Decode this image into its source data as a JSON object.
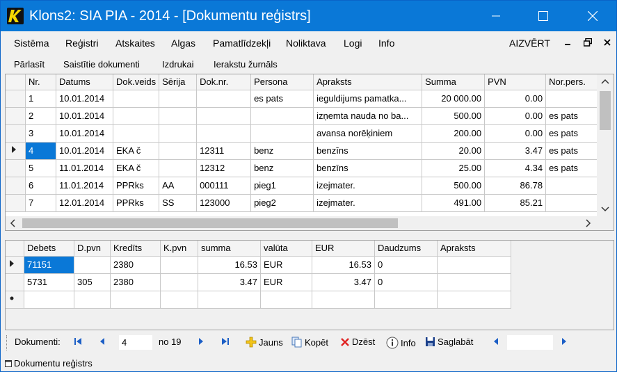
{
  "window": {
    "title": "Klons2: SIA PIA - 2014 - [Dokumentu reģistrs]"
  },
  "menu": {
    "items": [
      "Sistēma",
      "Reģistri",
      "Atskaites",
      "Algas",
      "Pamatlīdzekļi",
      "Noliktava",
      "Logi",
      "Info"
    ],
    "close_label": "AIZVĒRT"
  },
  "subtoolbar": [
    "Pārlasīt",
    "Saistītie dokumenti",
    "Izdrukai",
    "Ierakstu žurnāls"
  ],
  "documents": {
    "columns": [
      "Nr.",
      "Datums",
      "Dok.veids",
      "Sērija",
      "Dok.nr.",
      "Persona",
      "Apraksts",
      "Summa",
      "PVN",
      "Nor.pers."
    ],
    "rows": [
      [
        "1",
        "10.01.2014",
        "",
        "",
        "",
        "es pats",
        "ieguldijums pamatka...",
        "20 000.00",
        "0.00",
        ""
      ],
      [
        "2",
        "10.01.2014",
        "",
        "",
        "",
        "",
        "izņemta nauda no ba...",
        "500.00",
        "0.00",
        "es pats"
      ],
      [
        "3",
        "10.01.2014",
        "",
        "",
        "",
        "",
        "avansa norēķiniem",
        "200.00",
        "0.00",
        "es pats"
      ],
      [
        "4",
        "10.01.2014",
        "EKA č",
        "",
        "12311",
        "benz",
        "benzīns",
        "20.00",
        "3.47",
        "es pats"
      ],
      [
        "5",
        "11.01.2014",
        "EKA č",
        "",
        "12312",
        "benz",
        "benzīns",
        "25.00",
        "4.34",
        "es pats"
      ],
      [
        "6",
        "11.01.2014",
        "PPRks",
        "AA",
        "000111",
        "pieg1",
        "izejmater.",
        "500.00",
        "86.78",
        ""
      ],
      [
        "7",
        "12.01.2014",
        "PPRks",
        "SS",
        "123000",
        "pieg2",
        "izejmater.",
        "491.00",
        "85.21",
        ""
      ]
    ],
    "selected_row": 3
  },
  "entries": {
    "columns": [
      "Debets",
      "D.pvn",
      "Kredīts",
      "K.pvn",
      "summa",
      "valūta",
      "EUR",
      "Daudzums",
      "Apraksts"
    ],
    "rows": [
      [
        "71151",
        "",
        "2380",
        "",
        "16.53",
        "EUR",
        "16.53",
        "0",
        ""
      ],
      [
        "5731",
        "305",
        "2380",
        "",
        "3.47",
        "EUR",
        "3.47",
        "0",
        ""
      ]
    ]
  },
  "navigator": {
    "label": "Dokumenti:",
    "position": "4",
    "of_label": "no 19",
    "new_label": "Jauns",
    "copy_label": "Kopēt",
    "delete_label": "Dzēst",
    "info_label": "Info",
    "save_label": "Saglabāt"
  },
  "statusbar": {
    "tab": "Dokumentu reģistrs"
  },
  "colors": {
    "titlebar": "#0a78d7",
    "selection": "#0a78d7",
    "nav_arrow": "#1c5fc6"
  }
}
